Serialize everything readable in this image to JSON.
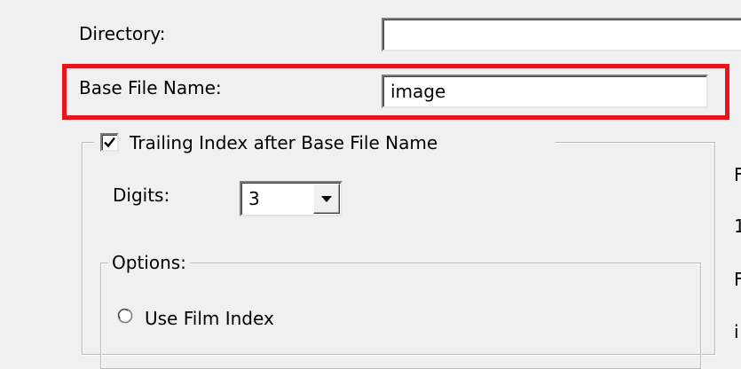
{
  "form": {
    "directory_label": "Directory:",
    "directory_value": "",
    "base_file_name_label": "Base File Name:",
    "base_file_name_value": "image"
  },
  "trailing_index": {
    "label": "Trailing Index after Base File Name",
    "checked": true,
    "digits_label": "Digits:",
    "digits_value": "3"
  },
  "options": {
    "legend": "Options:",
    "use_film_index_label": "Use Film Index",
    "use_film_index_selected": false
  },
  "right_column": {
    "line1": "F",
    "line2": "1",
    "line3": "F",
    "line4": "i"
  },
  "colors": {
    "highlight": "#e8141c",
    "window_bg": "#f0f0f0"
  },
  "icons": {
    "checkbox": "checkmark-icon",
    "combo": "chevron-down-icon",
    "radio": "radio-button-icon"
  }
}
